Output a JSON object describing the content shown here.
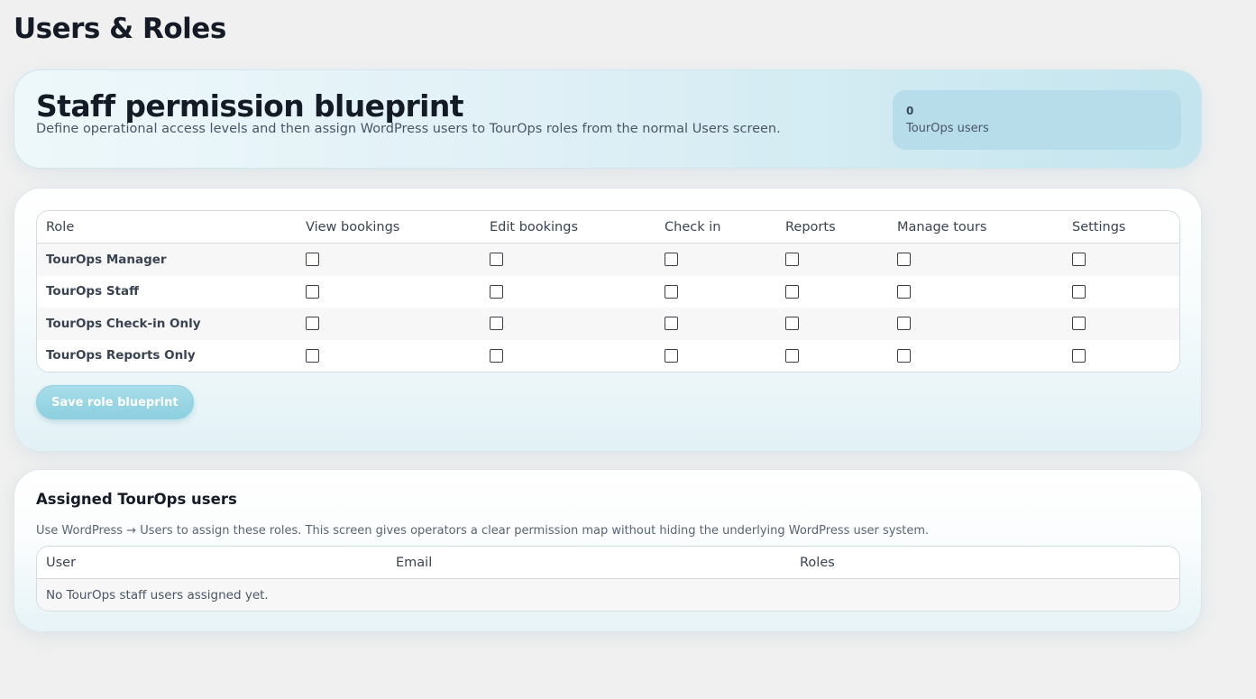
{
  "page": {
    "title": "Users & Roles"
  },
  "hero": {
    "title": "Staff permission blueprint",
    "description": "Define operational access levels and then assign WordPress users to TourOps roles from the normal Users screen.",
    "stat": {
      "value": "0",
      "label": "TourOps users"
    }
  },
  "permissions": {
    "columns": [
      "Role",
      "View bookings",
      "Edit bookings",
      "Check in",
      "Reports",
      "Manage tours",
      "Settings"
    ],
    "roles": [
      {
        "name": "TourOps Manager",
        "checks": [
          false,
          false,
          false,
          false,
          false,
          false
        ]
      },
      {
        "name": "TourOps Staff",
        "checks": [
          false,
          false,
          false,
          false,
          false,
          false
        ]
      },
      {
        "name": "TourOps Check-in Only",
        "checks": [
          false,
          false,
          false,
          false,
          false,
          false
        ]
      },
      {
        "name": "TourOps Reports Only",
        "checks": [
          false,
          false,
          false,
          false,
          false,
          false
        ]
      }
    ],
    "save_label": "Save role blueprint"
  },
  "assigned": {
    "title": "Assigned TourOps users",
    "description": "Use WordPress → Users to assign these roles. This screen gives operators a clear permission map without hiding the underlying WordPress user system.",
    "columns": [
      "User",
      "Email",
      "Roles"
    ],
    "empty_text": "No TourOps staff users assigned yet."
  },
  "colors": {
    "accent": "#8ccfdf",
    "stat_box": "#b6dde9",
    "page_bg": "#f0f0f0"
  }
}
